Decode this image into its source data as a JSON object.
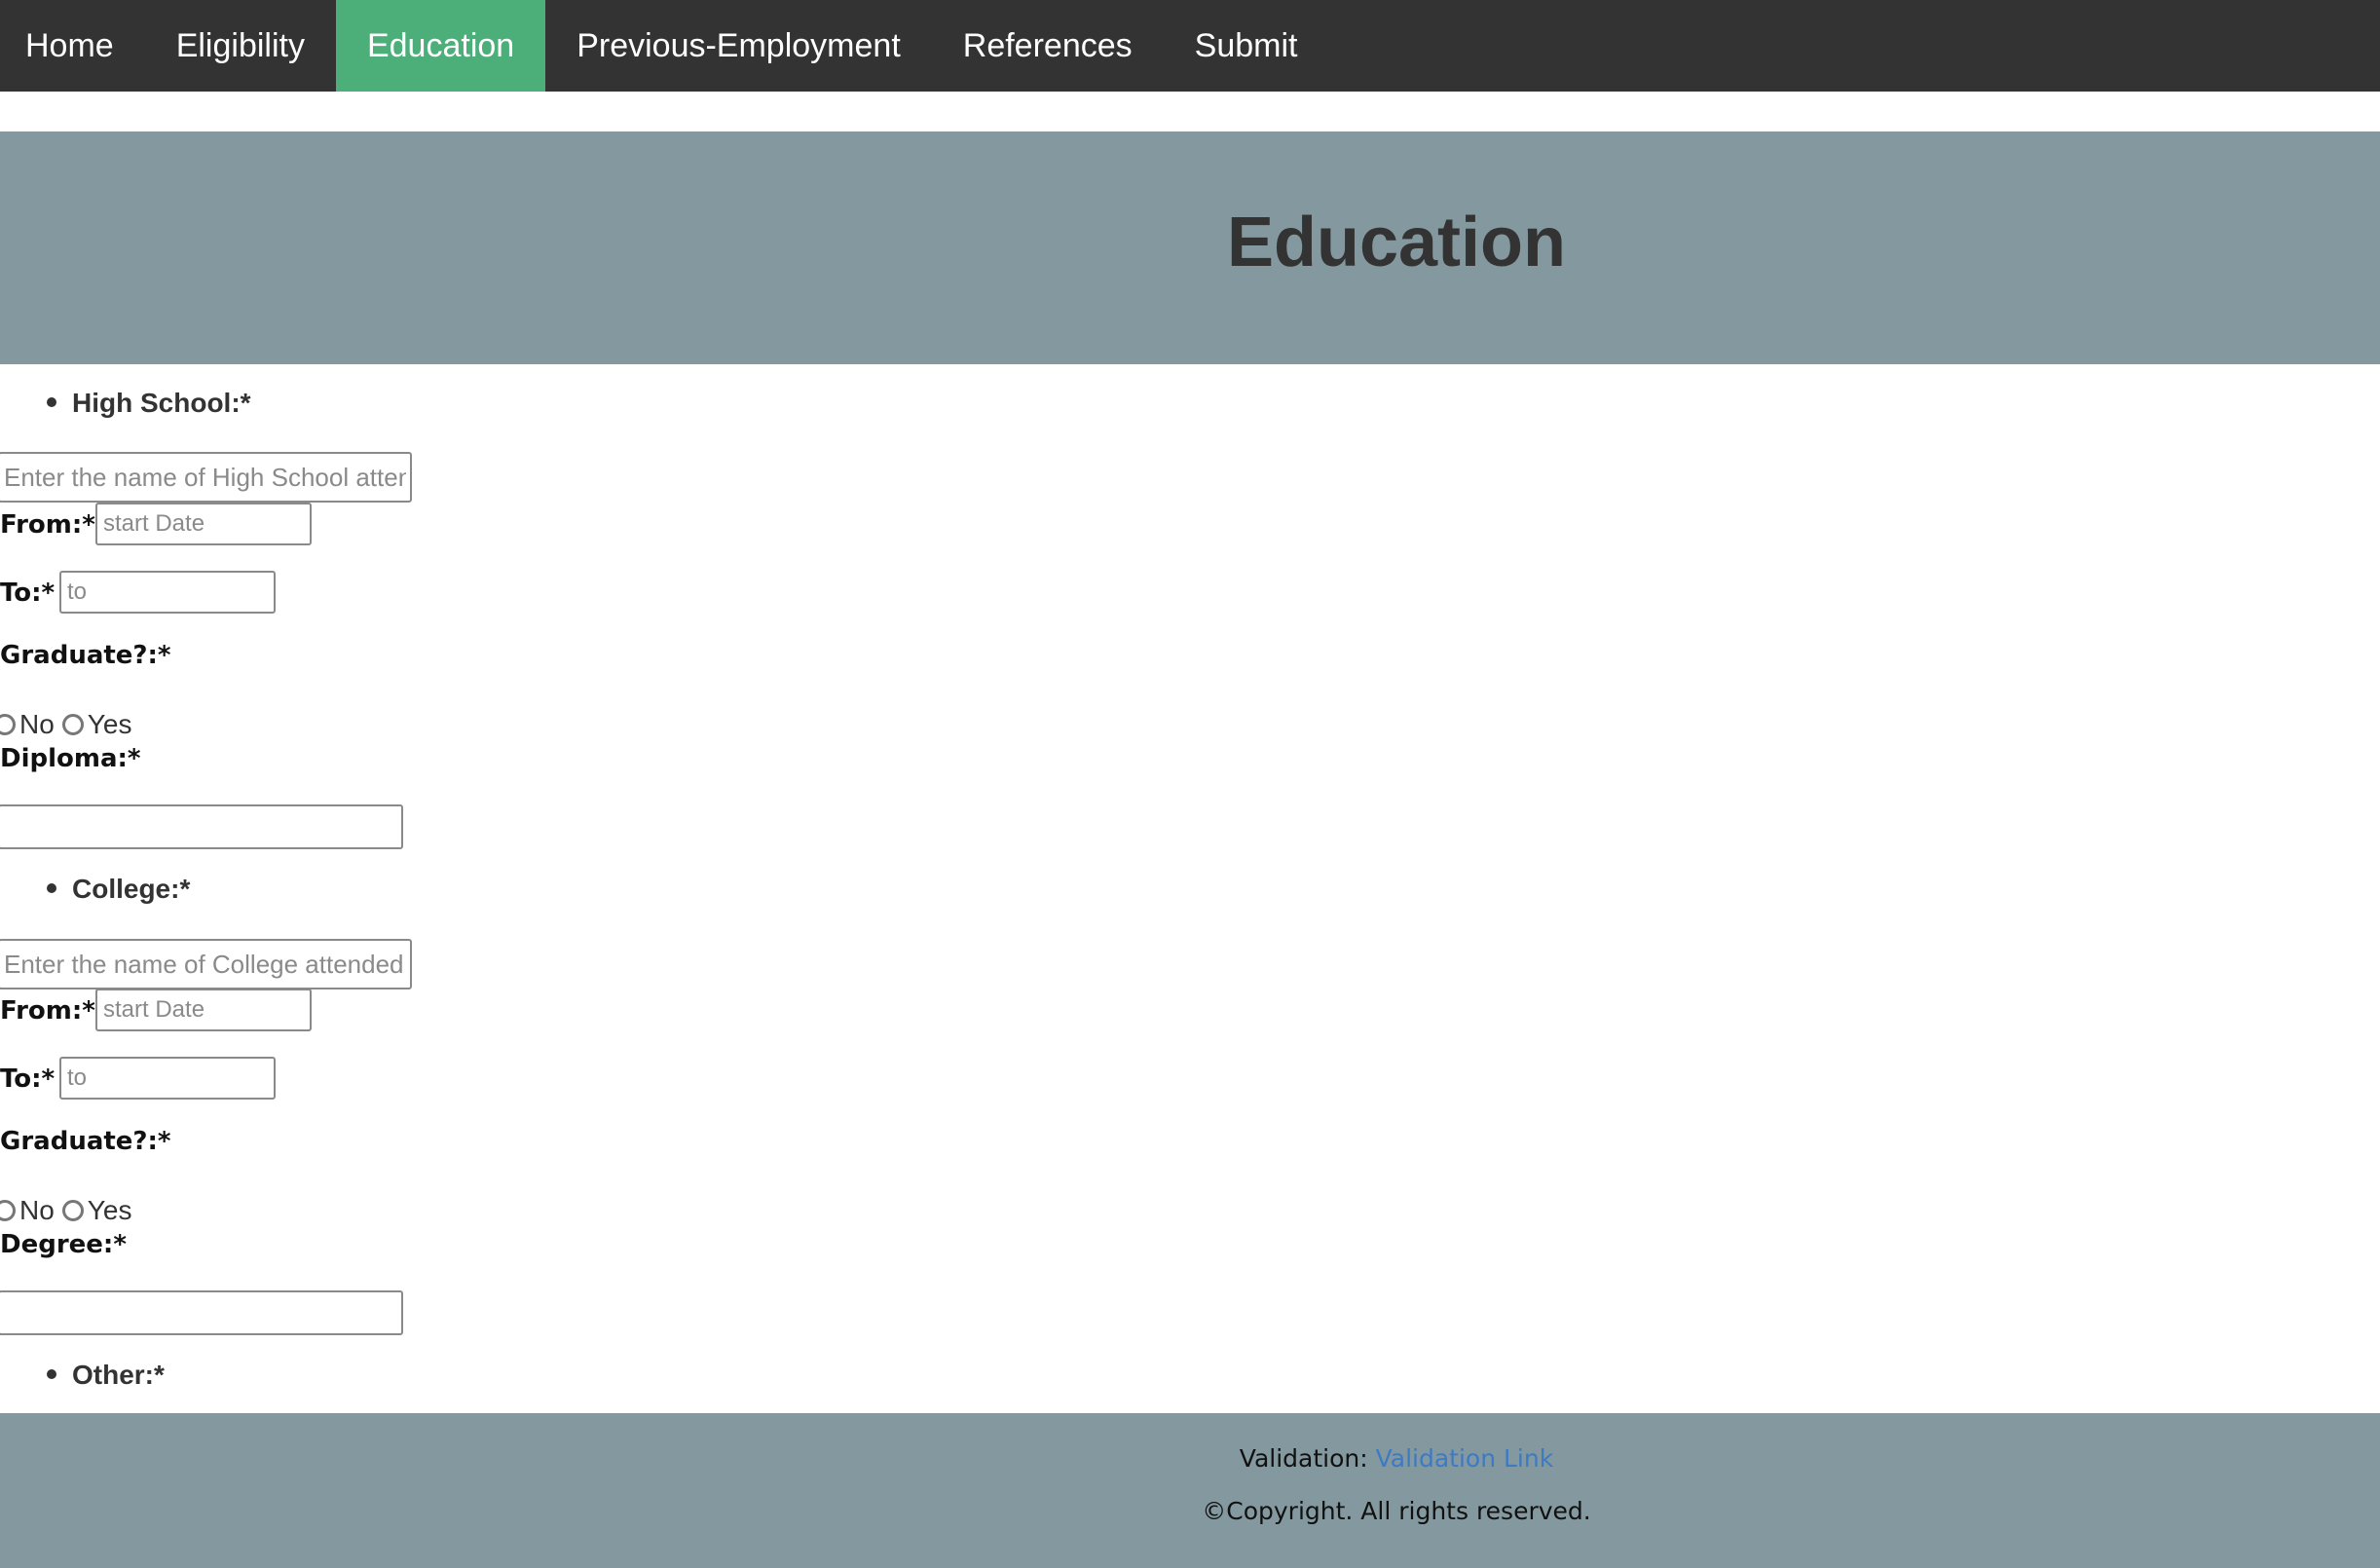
{
  "nav": {
    "items": [
      {
        "label": "Home",
        "active": false
      },
      {
        "label": "Eligibility",
        "active": false
      },
      {
        "label": "Education",
        "active": true
      },
      {
        "label": "Previous-Employment",
        "active": false
      },
      {
        "label": "References",
        "active": false
      },
      {
        "label": "Submit",
        "active": false
      }
    ],
    "active_color": "#4caf7a",
    "bar_color": "#333333"
  },
  "header": {
    "title": "Education",
    "band_color": "#83999f"
  },
  "high_school": {
    "title": "High School:*",
    "name_placeholder": "Enter the name of High School attended",
    "from_label": "From:*",
    "from_placeholder": "start Date",
    "to_label": "To:*",
    "to_placeholder": "to",
    "graduate_label": "Graduate?:*",
    "options": [
      "No",
      "Yes"
    ],
    "credential_label": "Diploma:*",
    "credential_value": ""
  },
  "college": {
    "title": "College:*",
    "name_placeholder": "Enter the name of College attended",
    "from_label": "From:*",
    "from_placeholder": "start Date",
    "to_label": "To:*",
    "to_placeholder": "to",
    "graduate_label": "Graduate?:*",
    "options": [
      "No",
      "Yes"
    ],
    "credential_label": "Degree:*",
    "credential_value": ""
  },
  "other": {
    "title": "Other:*"
  },
  "footer": {
    "validation_label": "Validation:",
    "validation_link": "Validation Link",
    "copyright": "©Copyright. All rights reserved.",
    "link_color": "#3d7ac4"
  }
}
